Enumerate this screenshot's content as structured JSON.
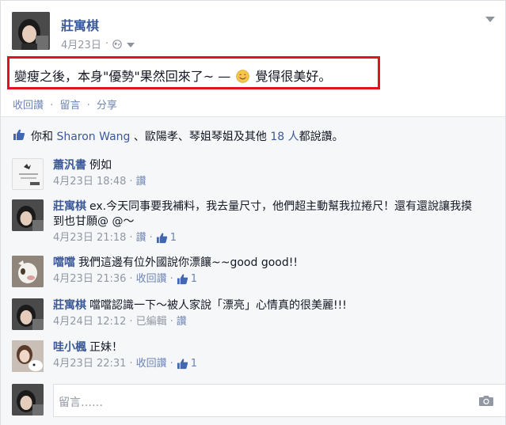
{
  "post": {
    "author": "莊寓棋",
    "date": "4月23日",
    "dot": "·",
    "status_pre": "變瘦之後，本身\"優勢\"果然回來了~ — ",
    "status_post": " 覺得很美好。",
    "status_emoji": "smiling-face-emoji",
    "actions": {
      "like": "收回讚",
      "comment": "留言",
      "share": "分享",
      "dot": "·"
    }
  },
  "likes": {
    "prefix": "你和 ",
    "first_name": "Sharon Wang",
    "middle": " 、歐陽孝、琴姐琴姐及其他 ",
    "count": "18 人",
    "suffix": "都說讚。"
  },
  "comments": [
    {
      "author": "蕭汎書",
      "text": "例如",
      "date": "4月23日 18:48",
      "action": "讚",
      "likes": ""
    },
    {
      "author": "莊寓棋",
      "text": "ex.今天同事要我補料，我去量尺寸，他們超主動幫我拉捲尺！還有還說讓我摸到也甘願@ @～",
      "date": "4月23日 21:18",
      "action": "讚",
      "likes": "1"
    },
    {
      "author": "噹噹",
      "text": "我們這邊有位外國說你漂饟~~good good!!",
      "date": "4月23日 21:36",
      "action": "收回讚",
      "likes": "1"
    },
    {
      "author": "莊寓棋",
      "text": "噹噹認識一下～被人家說「漂亮」心情真的很美麗!!!",
      "date": "4月24日 12:12",
      "edited": "已編輯",
      "action": "讚",
      "likes": ""
    },
    {
      "author": "哇小楓",
      "text": "正妹！",
      "date": "4月23日 22:31",
      "action": "收回讚",
      "likes": "1"
    }
  ],
  "comment_input": {
    "placeholder": "留言……"
  },
  "icons": {
    "privacy": "globe-icon",
    "like": "thumbs-up-icon",
    "camera": "camera-icon",
    "menu": "chevron-down-icon"
  },
  "colors": {
    "link": "#3b5998",
    "highlight_border": "#e0141e",
    "muted": "#9197a3",
    "light_bg": "#f6f7f9"
  }
}
